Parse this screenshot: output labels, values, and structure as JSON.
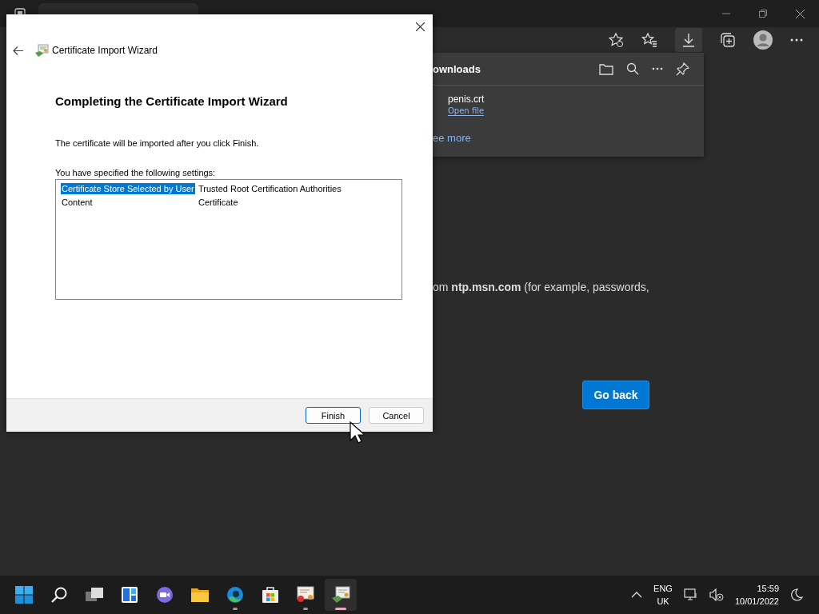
{
  "browser": {
    "downloads": {
      "title": "ownloads",
      "items": [
        {
          "name": "penis.crt",
          "action": "Open file"
        }
      ],
      "see_more": "ee more"
    },
    "page": {
      "text": "om **ntp.msn.com** (for example, passwords,",
      "button": "Go back"
    }
  },
  "dialog": {
    "title": "Certificate Import Wizard",
    "heading": "Completing the Certificate Import Wizard",
    "message": "The certificate will be imported after you click Finish.",
    "settings_label": "You have specified the following settings:",
    "settings": [
      {
        "name": "Certificate Store Selected by User",
        "value": "Trusted Root Certification Authorities",
        "selected": true
      },
      {
        "name": "Content",
        "value": "Certificate",
        "selected": false
      }
    ],
    "buttons": [
      {
        "label": "Finish",
        "default": true
      },
      {
        "label": "Cancel",
        "default": false
      }
    ]
  },
  "taskbar": {
    "apps": [
      {
        "kind": "start",
        "running": false,
        "active": false
      },
      {
        "kind": "search",
        "running": false,
        "active": false
      },
      {
        "kind": "taskview",
        "running": false,
        "active": false
      },
      {
        "kind": "widgets",
        "running": false,
        "active": false
      },
      {
        "kind": "chat",
        "running": false,
        "active": false
      },
      {
        "kind": "explorer",
        "running": false,
        "active": false
      },
      {
        "kind": "edge",
        "running": true,
        "active": false
      },
      {
        "kind": "store",
        "running": false,
        "active": false
      },
      {
        "kind": "certmgr",
        "running": true,
        "active": false
      },
      {
        "kind": "wizard",
        "running": true,
        "active": true
      }
    ],
    "tray": {
      "language": "ENG",
      "region": "UK",
      "time": "15:59",
      "date": "10/01/2022"
    }
  }
}
